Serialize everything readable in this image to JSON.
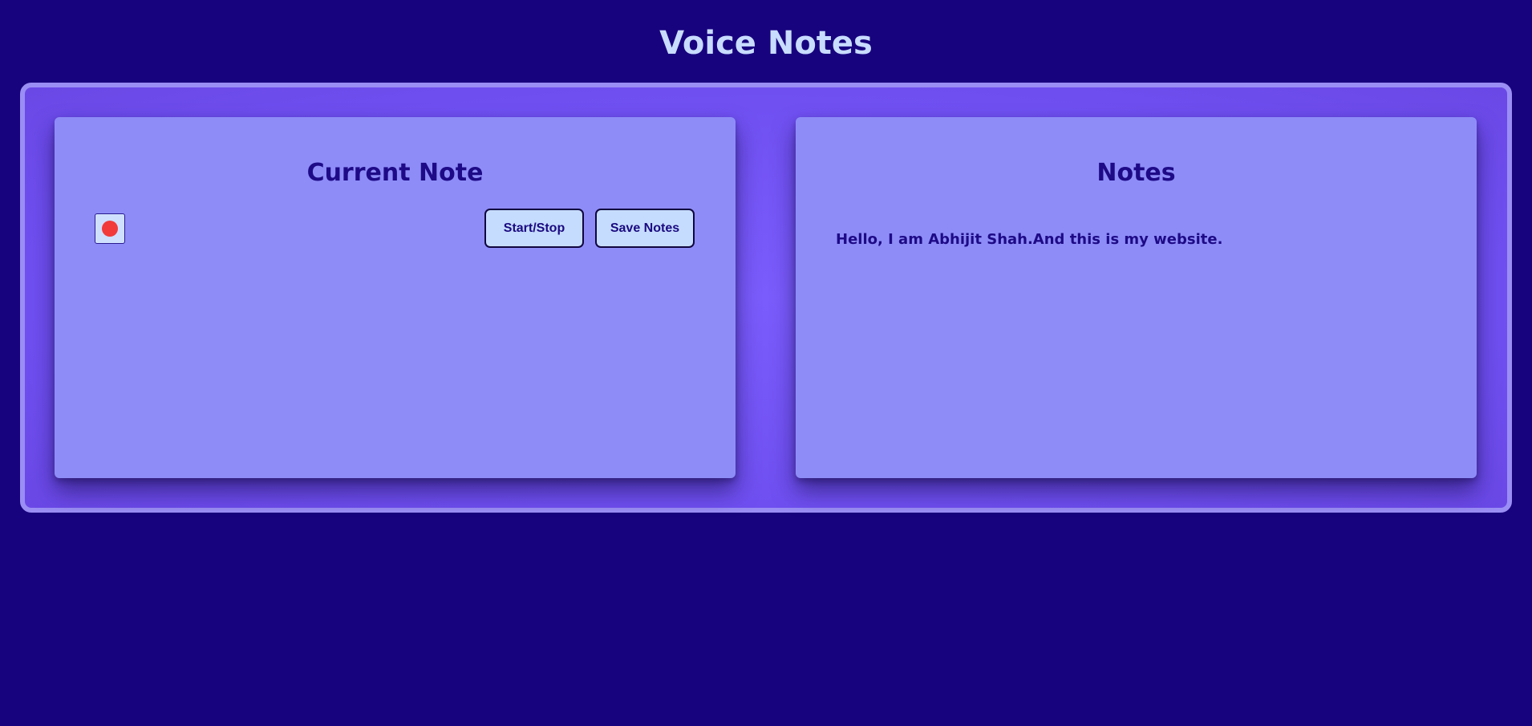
{
  "app": {
    "title": "Voice Notes"
  },
  "current_note": {
    "title": "Current Note",
    "record_indicator_color": "#f23a3a",
    "start_stop_label": "Start/Stop",
    "save_label": "Save Notes"
  },
  "notes": {
    "title": "Notes",
    "items": [
      "Hello, I am Abhijit Shah.And this is my website."
    ]
  },
  "colors": {
    "background": "#18037e",
    "panel": "#7a5cfc",
    "card": "#8e8df8",
    "title_text": "#c8dcff",
    "heading_text": "#1e0a86",
    "button_bg": "#c6dcff"
  }
}
